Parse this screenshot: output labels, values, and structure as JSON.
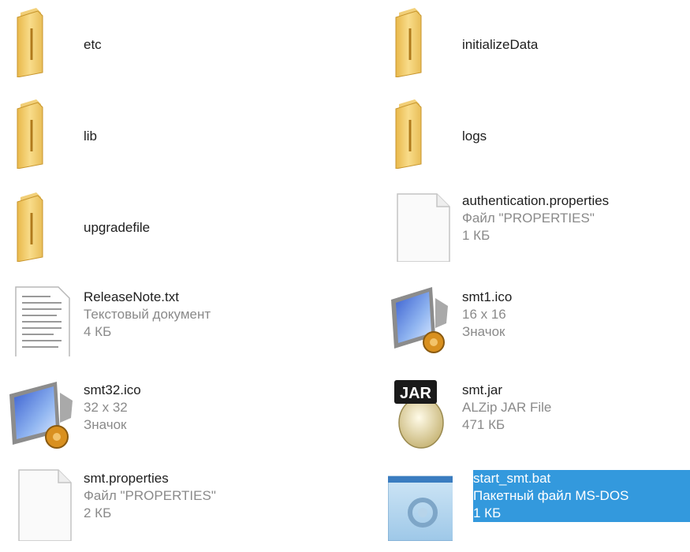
{
  "files": [
    {
      "name": "etc",
      "icon": "folder-icon"
    },
    {
      "name": "initializeData",
      "icon": "folder-icon"
    },
    {
      "name": "lib",
      "icon": "folder-icon"
    },
    {
      "name": "logs",
      "icon": "folder-icon"
    },
    {
      "name": "upgradefile",
      "icon": "folder-icon"
    },
    {
      "name": "authentication.properties",
      "type": "Файл \"PROPERTIES\"",
      "size": "1 КБ",
      "icon": "blank-file-icon"
    },
    {
      "name": "ReleaseNote.txt",
      "type": "Текстовый документ",
      "size": "4 КБ",
      "icon": "text-document-icon"
    },
    {
      "name": "smt1.ico",
      "type": "16 x 16",
      "size": "Значок",
      "icon": "monitor-gear-icon"
    },
    {
      "name": "smt32.ico",
      "type": "32 x 32",
      "size": "Значок",
      "icon": "monitor-gear-icon"
    },
    {
      "name": "smt.jar",
      "type": "ALZip JAR File",
      "size": "471 КБ",
      "icon": "jar-file-icon",
      "badge": "JAR"
    },
    {
      "name": "smt.properties",
      "type": "Файл \"PROPERTIES\"",
      "size": "2 КБ",
      "icon": "blank-file-icon"
    },
    {
      "name": "start_smt.bat",
      "type": "Пакетный файл MS-DOS",
      "size": "1 КБ",
      "icon": "batch-file-icon",
      "selected": true
    }
  ],
  "colors": {
    "selection": "#3399dd",
    "folder": "#f2cd6a",
    "meta_text": "#8a8a8a"
  }
}
